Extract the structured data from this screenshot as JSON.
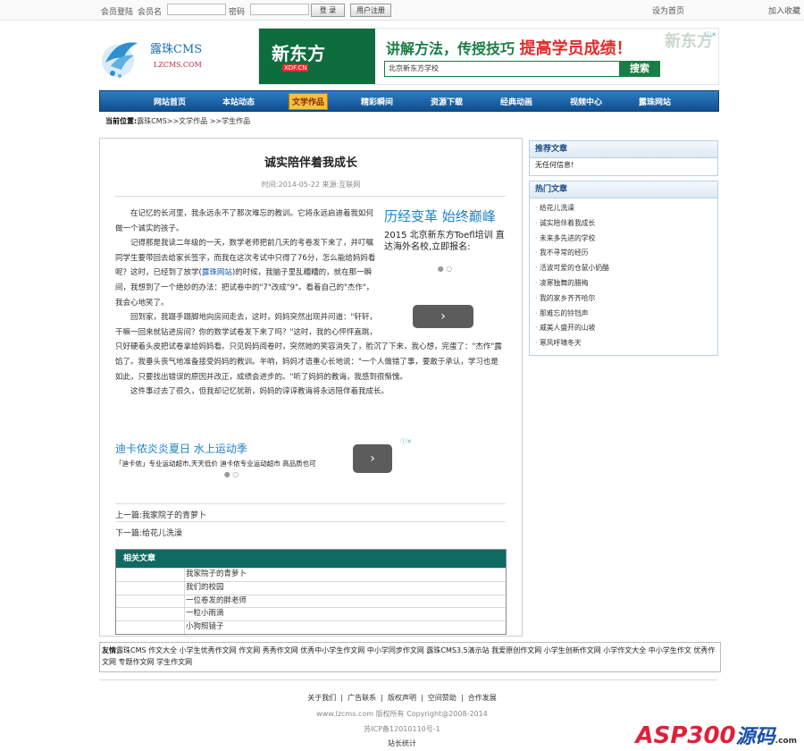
{
  "topbar": {
    "login_label": "会员登陆",
    "username_label": "会员名",
    "password_label": "密码",
    "login_button": "登 录",
    "register_button": "用户注册",
    "set_home": "设为首页",
    "add_favorite": "加入收藏"
  },
  "logo": {
    "name": "露珠CMS",
    "url": "LZCMS.COM"
  },
  "banner": {
    "brand": "新东方",
    "brand_sub": "XDF.CN",
    "slogan_prefix": "讲解方法，传授技巧",
    "slogan_hot": "提高学员成绩！",
    "search_value": "北京新东方学校",
    "search_button": "搜索",
    "ghost_text": "新东方"
  },
  "nav": {
    "items": [
      "网站首页",
      "本站动态",
      "文学作品",
      "精彩瞬间",
      "资源下载",
      "经典动画",
      "视频中心",
      "露珠网站"
    ],
    "active": "文学作品"
  },
  "breadcrumb": {
    "label": "当前位置:",
    "path": "露珠CMS>>文学作品 >>学生作品"
  },
  "article": {
    "title": "诚实陪伴着我成长",
    "meta": "时间:2014-05-22  来源:互联网",
    "paragraphs": [
      {
        "text": "在记忆的长河里，我永远永不了那次难忘的教训。它将永远启迪着我如何做一个诚实的孩子。"
      },
      {
        "before": "记得那是我读二年级的一天，数学老师把前几天的考卷发下来了，并叮嘱同学生要带回去给家长签字，而我在这次考试中只得了76分，怎么能给妈妈看呢？这时，已经到了放学(",
        "link": "露珠网站",
        "after": ")的时候，我脑子里乱糟糟的，就在那一瞬间，我想到了一个绝妙的办法：把试卷中的\"7\"改成\"9\"。看着自己的\"杰作\"，我会心地笑了。"
      },
      {
        "text": "回到家，我蹑手蹑脚地向房间走去，这时，妈妈突然出现并问道：\"轩轩，干嘛一回来就钻进房间？你的数学试卷发下来了吗？\"这时，我的心怦怦直跳，只好硬着头皮把试卷拿给妈妈看。只见妈妈阅卷时，突然她的笑容消失了，脸沉了下来，我心想，完蛋了：\"杰作\"露馅了。我垂头丧气地准备接受妈妈的教训。半响，妈妈才语重心长地说：\"一个人做错了事，要敢于承认，学习也是如此，只要找出错误的原因并改正，成绩会进步的。\"听了妈妈的教诲，我感到很惭愧。"
      },
      {
        "text": "这件事过去了很久，但我却记忆犹新，妈妈的谆谆教诲将永远陪伴着我成长。"
      }
    ],
    "prev": "上一篇:我家院子的青萝卜",
    "next": "下一篇:给花儿洗澡"
  },
  "float_ad": {
    "headline": "历经变革 始终巅峰",
    "text": "2015 北京新东方Toefl培训 直达海外名校,立即报名:",
    "arrow": "›"
  },
  "inline_ad": {
    "headline": "迪卡侬炎炎夏日 水上运动季",
    "text": "「迪卡侬」专业运动超市,天天低价 迪卡侬专业运动超市 高品质也可",
    "arrow": "›"
  },
  "related": {
    "heading": "相关文章",
    "items": [
      "我家院子的青萝卜",
      "我们的校园",
      "一位卷发的胖老师",
      "一粒小雨滴",
      "小狗照镜子"
    ]
  },
  "sidebar": {
    "recommended": {
      "heading": "推荐文章",
      "empty": "无任何信息!"
    },
    "popular": {
      "heading": "热门文章",
      "items": [
        "给花儿洗澡",
        "诚实陪伴着我成长",
        "未来多先进的学校",
        "我不寻常的经历",
        "活波可爱的仓鼠小奶酪",
        "凌寒独舞的腊梅",
        "我的家乡齐齐哈尔",
        "那难忘的铃铛声",
        "威美人盛开的山坡",
        "寒风呼啸冬天"
      ]
    }
  },
  "friends": {
    "label": "友情",
    "links": "露珠CMS 作文大全 小学生优秀作文网 作文网 秀秀作文网 优秀中小学生作文网 中小学同步作文网 露珠CMS3.5演示站 我爱原创作文网 小学生创新作文网 小学作文大全 中小学生作文 优秀作文网 专题作文网 学生作文网"
  },
  "footer": {
    "links": [
      "关于我们",
      "广告联系",
      "版权声明",
      "空间赞助",
      "合作发展"
    ],
    "copyright": "www.lzcms.com 版权所有 Copyright@2008-2014",
    "icp": "苏ICP备12010110号-1",
    "stats": "站长统计"
  },
  "watermark": {
    "brand": "ASP300",
    "cn": "源码",
    "sub": ".com"
  }
}
